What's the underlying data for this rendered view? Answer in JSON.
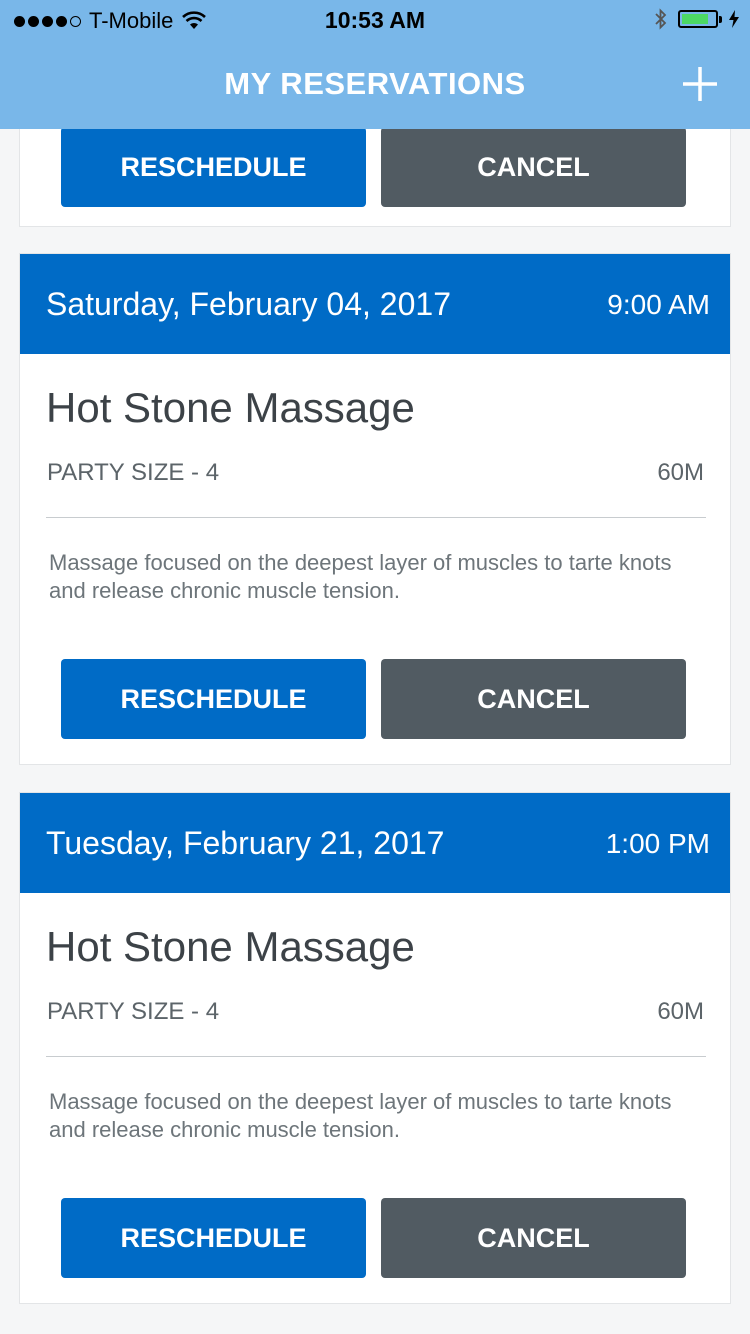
{
  "status_bar": {
    "carrier": "T-Mobile",
    "time": "10:53 AM",
    "signal_bars": 4,
    "signal_bars_total": 5,
    "battery_level": 0.8,
    "icons": [
      "wifi-icon",
      "bluetooth-icon",
      "battery-icon",
      "charging-icon"
    ]
  },
  "header": {
    "title": "MY RESERVATIONS",
    "add_icon": "plus-icon"
  },
  "reservations": [
    {
      "partial": true,
      "reschedule_label": "RESCHEDULE",
      "cancel_label": "CANCEL"
    },
    {
      "date": "Saturday, February 04, 2017",
      "time": "9:00 AM",
      "service": "Hot Stone Massage",
      "party_size": "PARTY SIZE - 4",
      "duration": "60M",
      "description": "Massage focused on the deepest layer of muscles to tarte knots and release chronic muscle tension.",
      "reschedule_label": "RESCHEDULE",
      "cancel_label": "CANCEL"
    },
    {
      "date": "Tuesday, February 21, 2017",
      "time": "1:00 PM",
      "service": "Hot Stone Massage",
      "party_size": "PARTY SIZE - 4",
      "duration": "60M",
      "description": "Massage focused on the deepest layer of muscles to tarte knots and release chronic muscle tension.",
      "reschedule_label": "RESCHEDULE",
      "cancel_label": "CANCEL"
    }
  ],
  "colors": {
    "nav_bar": "#79b7e9",
    "card_header": "#006bc6",
    "reschedule_button": "#006bc6",
    "cancel_button": "#515b62"
  }
}
